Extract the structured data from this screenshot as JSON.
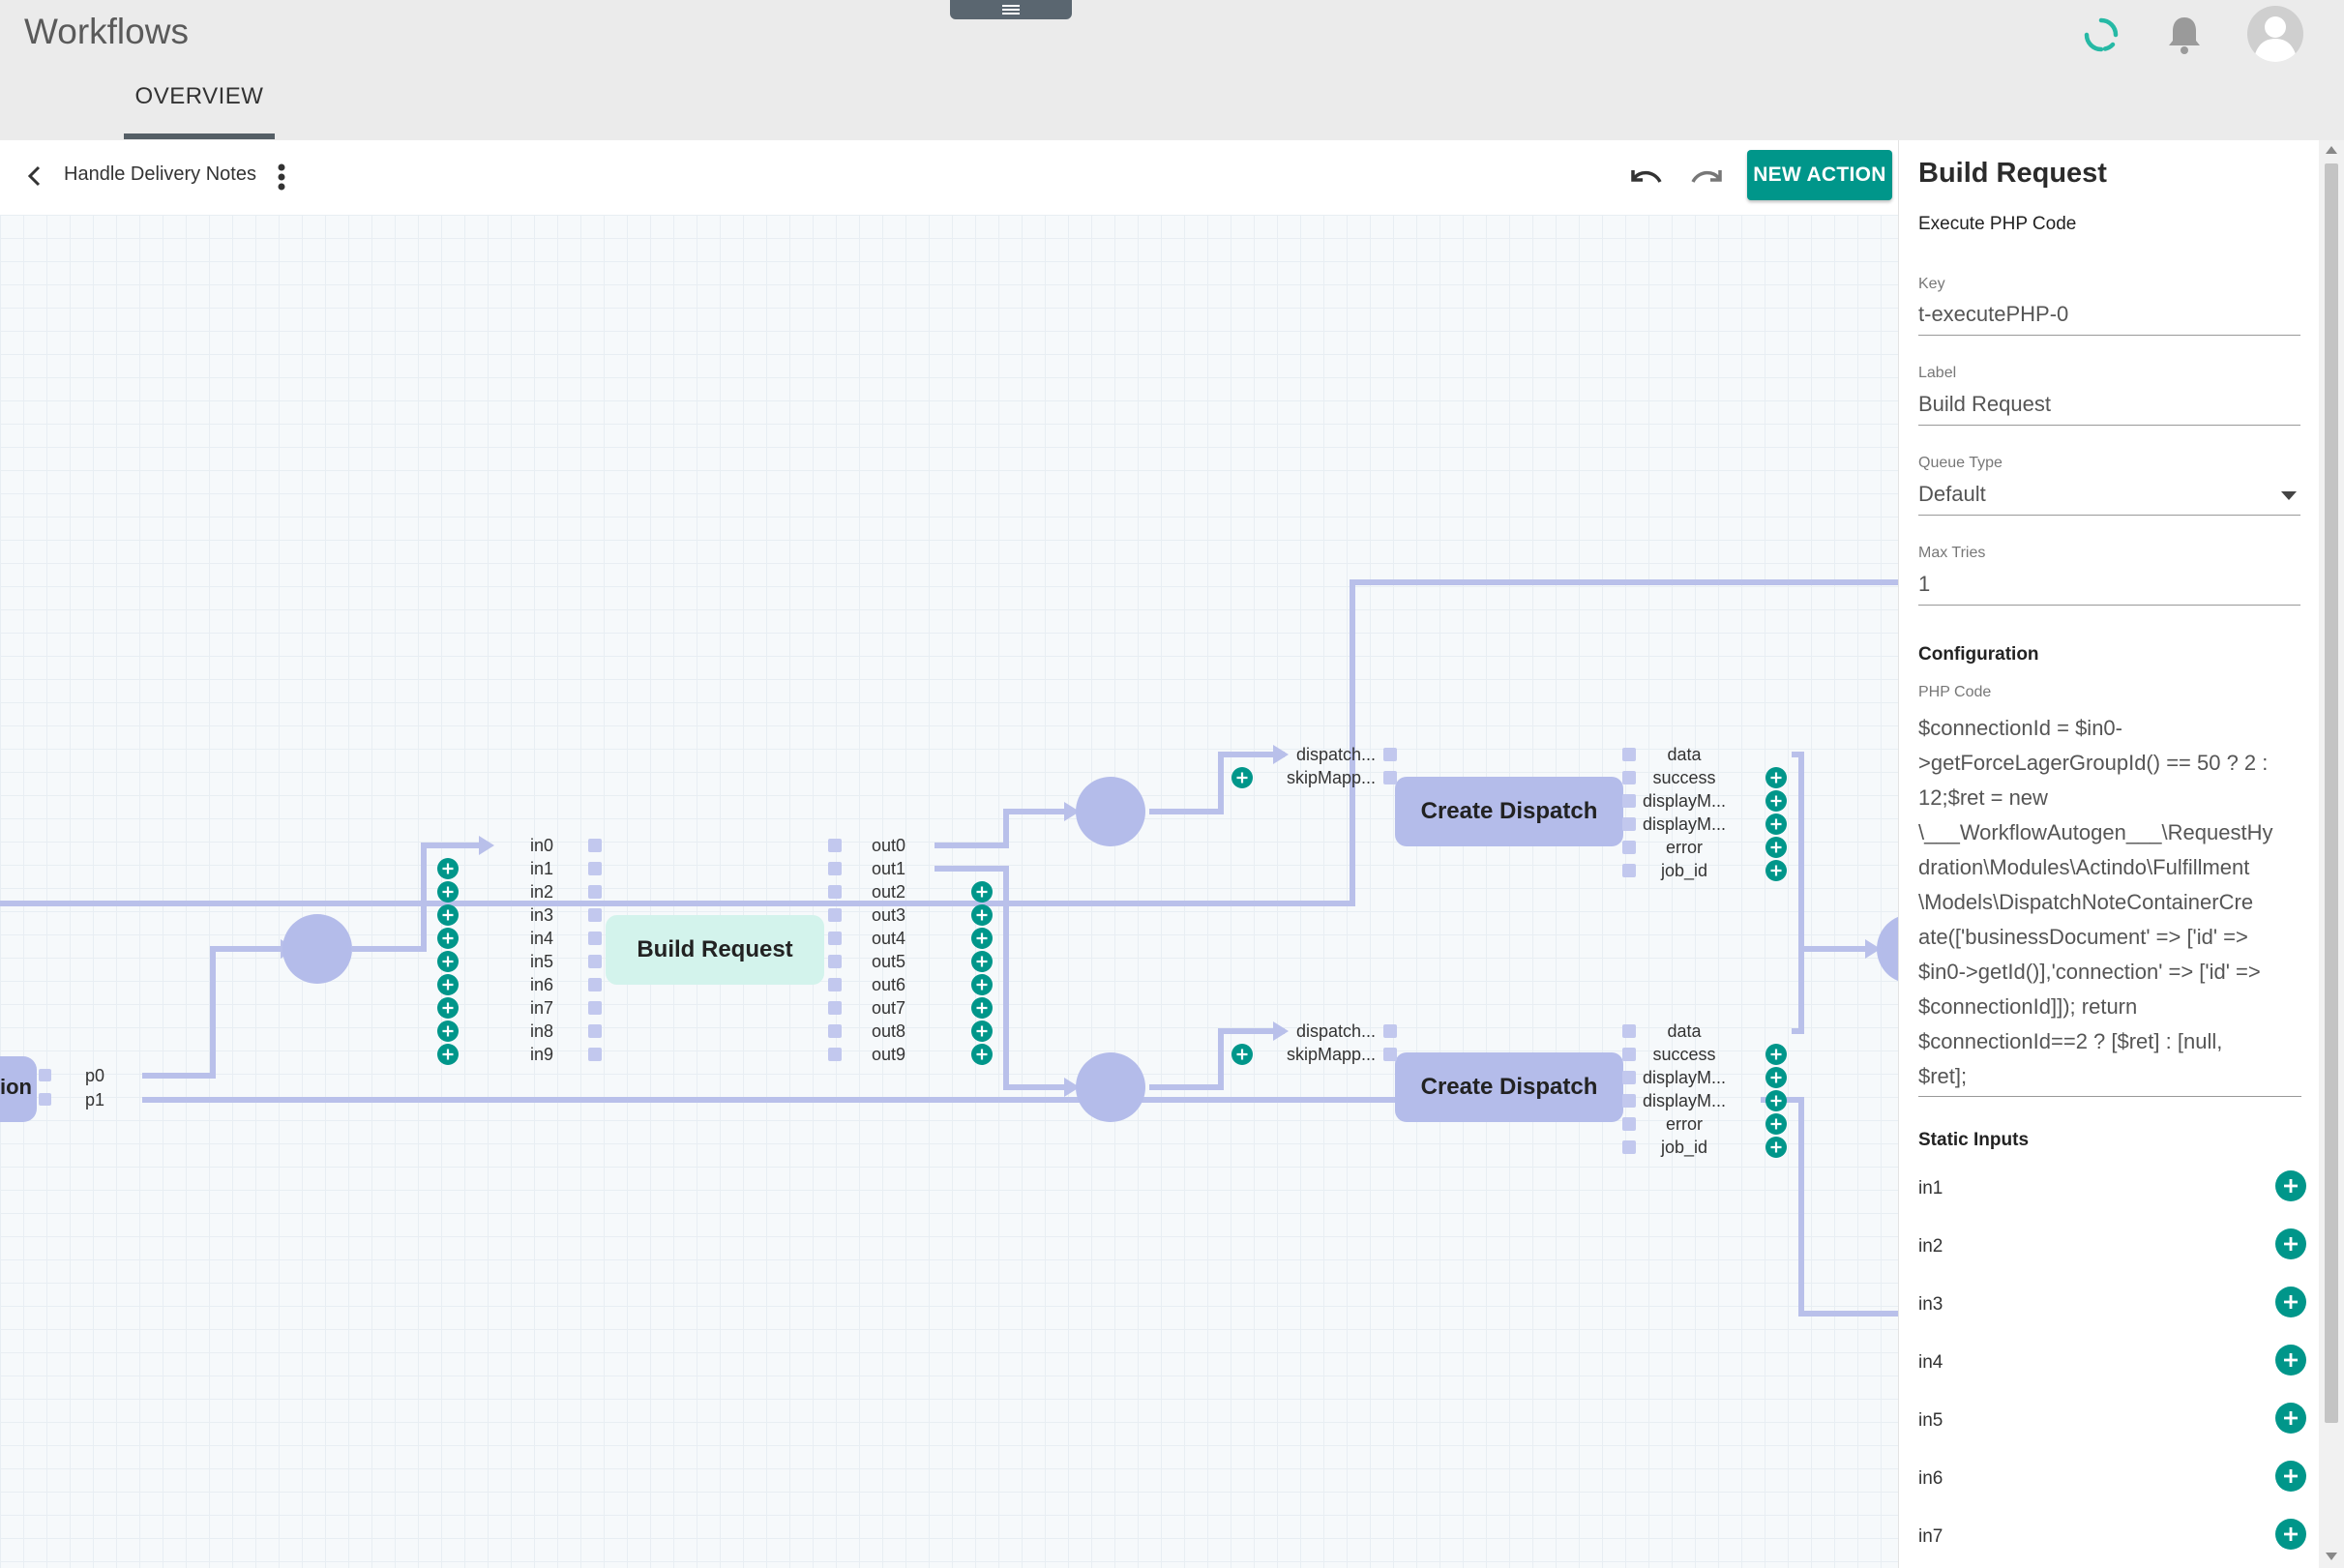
{
  "app": {
    "title": "Workflows"
  },
  "tabs": [
    {
      "label": "OVERVIEW"
    }
  ],
  "header": {
    "icons": [
      "sync-icon",
      "bell-icon",
      "user-avatar-icon"
    ]
  },
  "toolbar": {
    "workflow_name": "Handle Delivery Notes",
    "new_action_label": "NEW ACTION"
  },
  "colors": {
    "accent": "#00968a",
    "node_fill": "#b4bcea",
    "wire": "#b9c0ea",
    "selected_node": "#d3f3ec",
    "port": "#c2c8ee"
  },
  "canvas": {
    "partial_node": {
      "label": "ion",
      "outputs": [
        "p0",
        "p1"
      ]
    },
    "build_request_node": {
      "label": "Build Request",
      "inputs": [
        "in0",
        "in1",
        "in2",
        "in3",
        "in4",
        "in5",
        "in6",
        "in7",
        "in8",
        "in9"
      ],
      "outputs": [
        "out0",
        "out1",
        "out2",
        "out3",
        "out4",
        "out5",
        "out6",
        "out7",
        "out8",
        "out9"
      ]
    },
    "create_dispatch_top": {
      "label": "Create Dispatch",
      "inputs": [
        "dispatch...",
        "skipMapp..."
      ],
      "outputs": [
        "data",
        "success",
        "displayM...",
        "displayM...",
        "error",
        "job_id"
      ]
    },
    "create_dispatch_bottom": {
      "label": "Create Dispatch",
      "inputs": [
        "dispatch...",
        "skipMapp..."
      ],
      "outputs": [
        "data",
        "success",
        "displayM...",
        "displayM...",
        "error",
        "job_id"
      ]
    }
  },
  "panel": {
    "title": "Build Request",
    "subtitle": "Execute PHP Code",
    "fields": {
      "key": {
        "label": "Key",
        "value": "t-executePHP-0"
      },
      "label": {
        "label": "Label",
        "value": "Build Request"
      },
      "queue_type": {
        "label": "Queue Type",
        "value": "Default"
      },
      "max_tries": {
        "label": "Max Tries",
        "value": "1"
      }
    },
    "configuration_heading": "Configuration",
    "php_code_label": "PHP Code",
    "php_code_lines": [
      "$connectionId = $in0-",
      ">getForceLagerGroupId() == 50 ? 2 :",
      "12;$ret = new",
      "\\___WorkflowAutogen___\\RequestHy",
      "dration\\Modules\\Actindo\\Fulfillment",
      "\\Models\\DispatchNoteContainerCre",
      "ate(['businessDocument' => ['id' =>",
      "$in0->getId()],'connection' => ['id' =>",
      "$connectionId]]); return",
      "$connectionId==2 ?  [$ret] : [null,",
      "$ret];"
    ],
    "static_inputs_heading": "Static Inputs",
    "static_inputs": [
      "in1",
      "in2",
      "in3",
      "in4",
      "in5",
      "in6",
      "in7"
    ]
  }
}
